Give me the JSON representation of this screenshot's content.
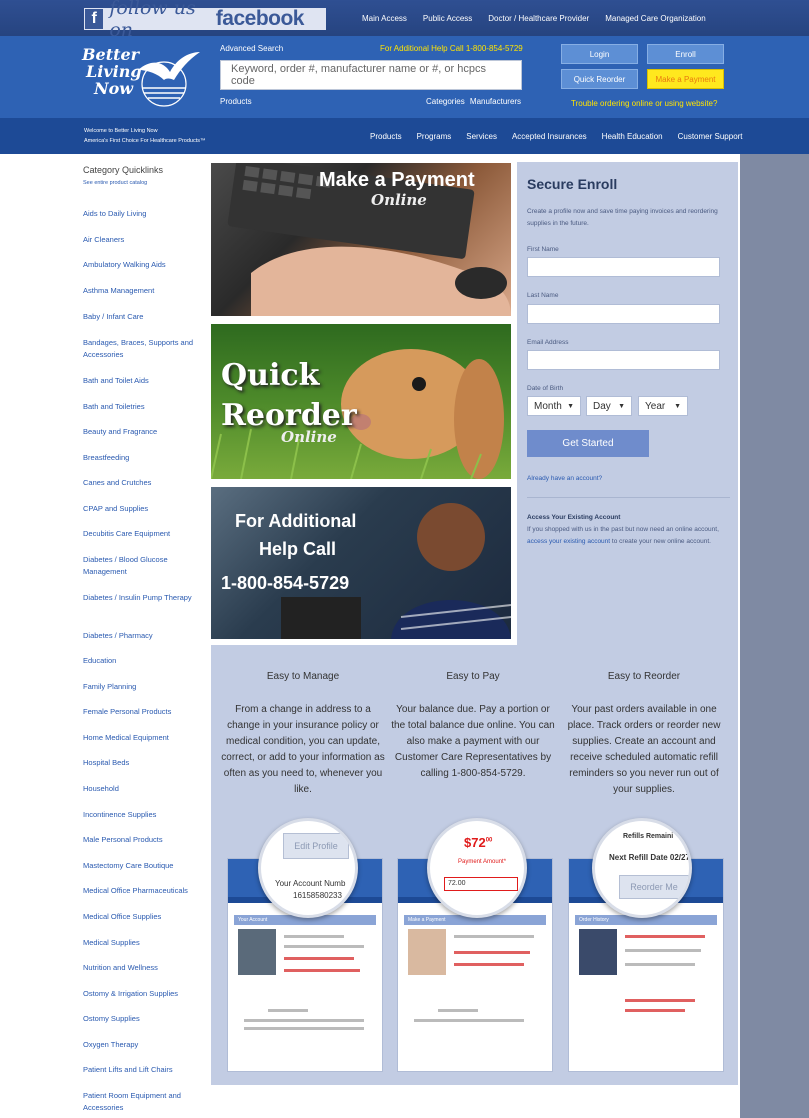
{
  "topbar": {
    "facebook_follow": "follow us on",
    "facebook_name": "facebook",
    "facebook_f": "f",
    "links": [
      "Main Access",
      "Public Access",
      "Doctor / Healthcare Provider",
      "Managed Care Organization"
    ]
  },
  "header": {
    "logo_lines": [
      "Better",
      "Living",
      "Now"
    ],
    "advanced_search": "Advanced Search",
    "help_line": "For Additional Help Call 1-800-854-5729",
    "search_placeholder": "Keyword, order #, manufacturer name or #, or hcpcs code",
    "products_label": "Products",
    "categories_label": "Categories",
    "manufacturers_label": "Manufacturers",
    "login": "Login",
    "enroll": "Enroll",
    "quick_reorder": "Quick Reorder",
    "make_payment": "Make a Payment",
    "trouble": "Trouble ordering online or using website?"
  },
  "subnav": {
    "welcome_1": "Welcome to Better Living Now",
    "welcome_2": "America's First Choice For Healthcare Products™",
    "items": [
      "Products",
      "Programs",
      "Services",
      "Accepted Insurances",
      "Health Education",
      "Customer Support"
    ]
  },
  "sidebar": {
    "title": "Category Quicklinks",
    "subtitle": "See entire product catalog",
    "items": [
      "Aids to Daily Living",
      "Air Cleaners",
      "Ambulatory Walking Aids",
      "Asthma Management",
      "Baby / Infant Care",
      "Bandages, Braces, Supports and Accessories",
      "Bath and Toilet Aids",
      "Bath and Toiletries",
      "Beauty and Fragrance",
      "Breastfeeding",
      "Canes and Crutches",
      "CPAP and Supplies",
      "Decubitis Care Equipment",
      "Diabetes / Blood Glucose Management",
      "Diabetes / Insulin Pump Therapy",
      "Diabetes / Pharmacy",
      "Education",
      "Family Planning",
      "Female Personal Products",
      "Home Medical Equipment",
      "Hospital Beds",
      "Household",
      "Incontinence Supplies",
      "Male Personal Products",
      "Mastectomy Care Boutique",
      "Medical Office Pharmaceuticals",
      "Medical Office Supplies",
      "Medical Supplies",
      "Nutrition and Wellness",
      "Ostomy & Irrigation Supplies",
      "Ostomy Supplies",
      "Oxygen Therapy",
      "Patient Lifts and Lift Chairs",
      "Patient Room Equipment and Accessories"
    ]
  },
  "promos": {
    "payment_title": "Make a Payment",
    "payment_sub": "Online",
    "reorder_title_1": "Quick",
    "reorder_title_2": "Reorder",
    "reorder_sub": "Online",
    "help_1": "For Additional",
    "help_2": "Help Call",
    "help_3": "1-800-854-5729"
  },
  "enroll": {
    "title": "Secure Enroll",
    "desc": "Create a profile now and save time paying invoices and reordering supplies in the future.",
    "first_name": "First Name",
    "last_name": "Last Name",
    "email": "Email Address",
    "dob": "Date of Birth",
    "month": "Month",
    "day": "Day",
    "year": "Year",
    "button": "Get Started",
    "already": "Already have an account?",
    "access_title": "Access Your Existing Account",
    "access_text_1": "If you shopped with us in the past but now need an online account,",
    "access_link": "access your existing account",
    "access_text_2": "to create your new online account."
  },
  "features": [
    {
      "heading": "Easy to Manage",
      "text": "From a change in address to a change in your insurance policy or medical condition, you can update, correct, or add to your information as often as you need to, whenever you like."
    },
    {
      "heading": "Easy to Pay",
      "text": "Your balance due. Pay a portion or the total balance due online. You can also make a payment with our Customer Care Representatives by calling 1-800-854-5729."
    },
    {
      "heading": "Easy to Reorder",
      "text": "Your past orders available in one place. Track orders or reorder new supplies. Create an account and receive scheduled automatic refill reminders so you never run out of your supplies."
    }
  ],
  "magnifiers": {
    "edit_profile": "Edit Profile",
    "account_number": "Your Account Numb",
    "account_value": "16158580233",
    "price": "$72",
    "price_cents": "00",
    "payment_amount": "Payment Amount*",
    "payment_value": "72.00",
    "refills": "Refills Remaini",
    "next_refill": "Next Refill Date 02/27/2",
    "reorder_me": "Reorder Me"
  },
  "mini_shots": {
    "a": "Your Account",
    "b": "Make a Payment",
    "c": "Order History"
  }
}
